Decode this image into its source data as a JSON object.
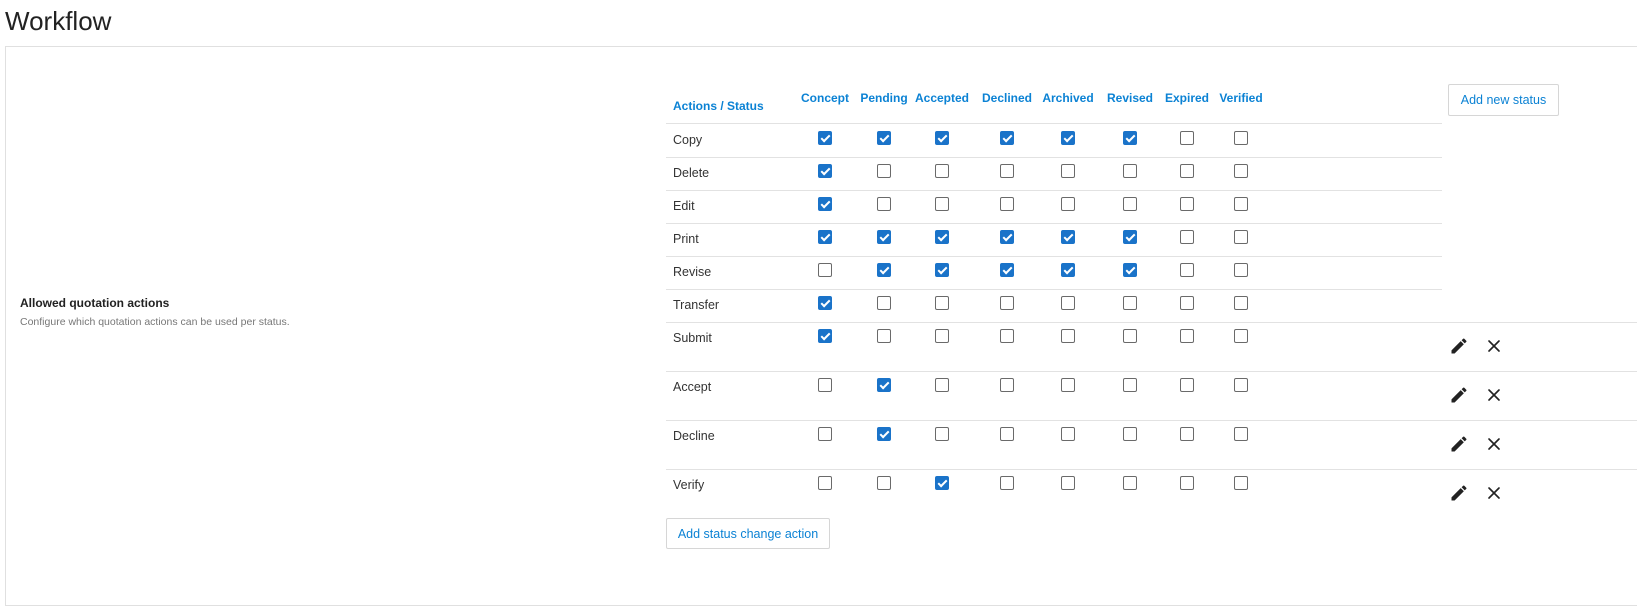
{
  "page": {
    "title": "Workflow"
  },
  "setting": {
    "title": "Allowed quotation actions",
    "description": "Configure which quotation actions can be used per status."
  },
  "table": {
    "header_action_label": "Actions / Status",
    "statuses": [
      "Concept",
      "Pending",
      "Accepted",
      "Declined",
      "Archived",
      "Revised",
      "Expired",
      "Verified"
    ],
    "rows": [
      {
        "label": "Copy",
        "checks": [
          true,
          true,
          true,
          true,
          true,
          true,
          false,
          false
        ],
        "editable": false
      },
      {
        "label": "Delete",
        "checks": [
          true,
          false,
          false,
          false,
          false,
          false,
          false,
          false
        ],
        "editable": false
      },
      {
        "label": "Edit",
        "checks": [
          true,
          false,
          false,
          false,
          false,
          false,
          false,
          false
        ],
        "editable": false
      },
      {
        "label": "Print",
        "checks": [
          true,
          true,
          true,
          true,
          true,
          true,
          false,
          false
        ],
        "editable": false
      },
      {
        "label": "Revise",
        "checks": [
          false,
          true,
          true,
          true,
          true,
          true,
          false,
          false
        ],
        "editable": false
      },
      {
        "label": "Transfer",
        "checks": [
          true,
          false,
          false,
          false,
          false,
          false,
          false,
          false
        ],
        "editable": false
      },
      {
        "label": "Submit",
        "checks": [
          true,
          false,
          false,
          false,
          false,
          false,
          false,
          false
        ],
        "editable": true
      },
      {
        "label": "Accept",
        "checks": [
          false,
          true,
          false,
          false,
          false,
          false,
          false,
          false
        ],
        "editable": true
      },
      {
        "label": "Decline",
        "checks": [
          false,
          true,
          false,
          false,
          false,
          false,
          false,
          false
        ],
        "editable": true
      },
      {
        "label": "Verify",
        "checks": [
          false,
          false,
          true,
          false,
          false,
          false,
          false,
          false
        ],
        "editable": true
      }
    ]
  },
  "buttons": {
    "add_status": "Add new status",
    "add_action": "Add status change action"
  },
  "icons": {
    "edit": "pencil-icon",
    "delete": "close-icon"
  },
  "colors": {
    "accent": "#0b82d4",
    "checked": "#1a73c9"
  }
}
